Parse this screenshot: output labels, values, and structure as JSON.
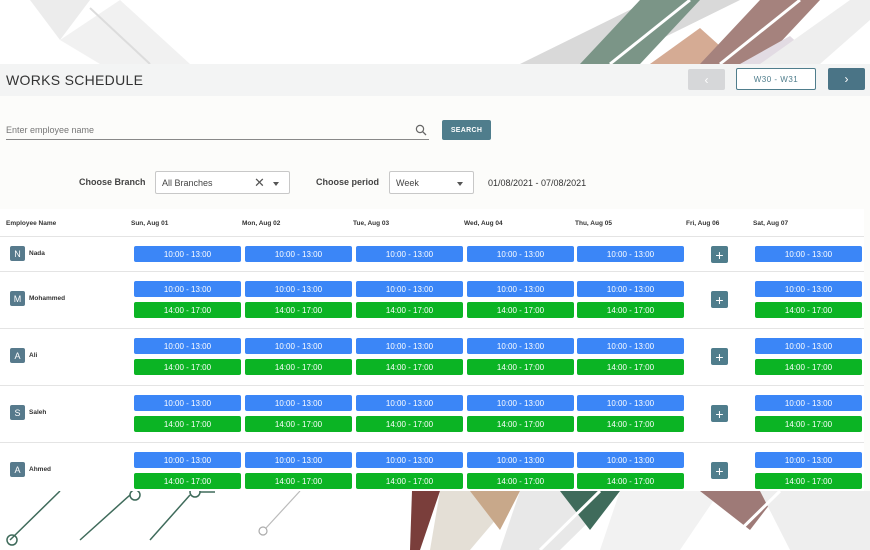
{
  "header": {
    "title": "WORKS SCHEDULE",
    "prev_glyph": "‹",
    "week_range": "W30 - W31",
    "next_glyph": "›"
  },
  "search": {
    "placeholder": "Enter employee name",
    "value": "",
    "button_label": "SEARCH"
  },
  "filters": {
    "branch_label": "Choose Branch",
    "branch_value": "All Branches",
    "clear_glyph": "✕",
    "period_label": "Choose period",
    "period_value": "Week",
    "date_range": "01/08/2021 - 07/08/2021"
  },
  "table": {
    "employee_col": "Employee Name",
    "days": [
      "Sun, Aug 01",
      "Mon, Aug 02",
      "Tue, Aug 03",
      "Wed, Aug 04",
      "Thu, Aug 05",
      "Fri, Aug 06",
      "Sat, Aug 07"
    ],
    "add_glyph": "+",
    "rows": [
      {
        "initial": "N",
        "name": "Nada",
        "shifts": [
          "10:00 - 13:00"
        ]
      },
      {
        "initial": "M",
        "name": "Mohammed",
        "shifts": [
          "10:00 - 13:00",
          "14:00 - 17:00"
        ]
      },
      {
        "initial": "A",
        "name": "Ali",
        "shifts": [
          "10:00 - 13:00",
          "14:00 - 17:00"
        ]
      },
      {
        "initial": "S",
        "name": "Saleh",
        "shifts": [
          "10:00 - 13:00",
          "14:00 - 17:00"
        ]
      },
      {
        "initial": "A",
        "name": "Ahmed",
        "shifts": [
          "10:00 - 13:00",
          "14:00 - 17:00"
        ]
      }
    ]
  },
  "colors": {
    "am_shift": "#3b86f7",
    "pm_shift": "#0bb424",
    "accent": "#4f7d8c"
  },
  "icons": {
    "search": "search-icon",
    "prev": "chevron-left-icon",
    "next": "chevron-right-icon",
    "clear": "close-icon",
    "dropdown": "caret-down-icon",
    "add": "plus-icon"
  }
}
